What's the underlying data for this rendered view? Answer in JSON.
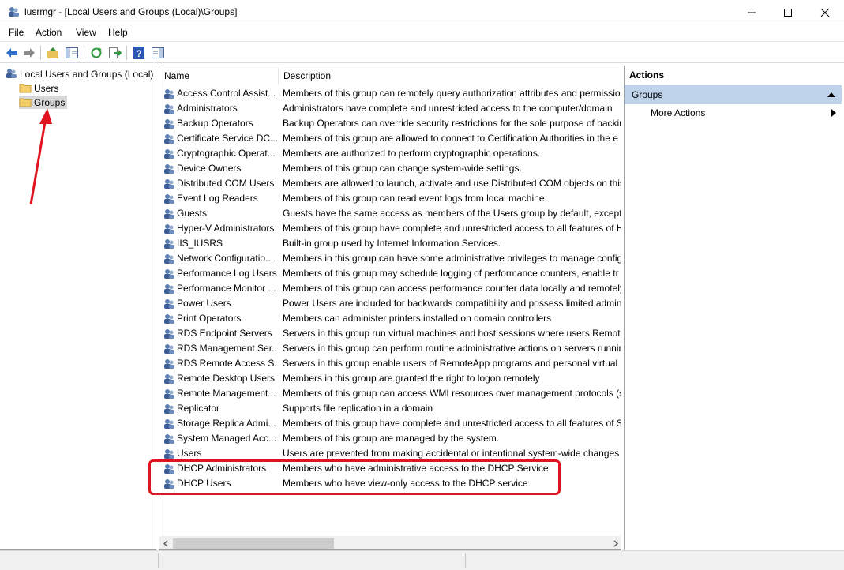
{
  "window": {
    "title": "lusrmgr - [Local Users and Groups (Local)\\Groups]"
  },
  "menu": [
    {
      "label": "File"
    },
    {
      "label": "Action"
    },
    {
      "label": "View"
    },
    {
      "label": "Help"
    }
  ],
  "tree": {
    "root": "Local Users and Groups (Local)",
    "items": [
      {
        "label": "Users"
      },
      {
        "label": "Groups"
      }
    ]
  },
  "list": {
    "columns": [
      "Name",
      "Description"
    ],
    "rows": [
      {
        "name": "Access Control Assist...",
        "desc": "Members of this group can remotely query authorization attributes and permissio"
      },
      {
        "name": "Administrators",
        "desc": "Administrators have complete and unrestricted access to the computer/domain"
      },
      {
        "name": "Backup Operators",
        "desc": "Backup Operators can override security restrictions for the sole purpose of backin"
      },
      {
        "name": "Certificate Service DC...",
        "desc": "Members of this group are allowed to connect to Certification Authorities in the e"
      },
      {
        "name": "Cryptographic Operat...",
        "desc": "Members are authorized to perform cryptographic operations."
      },
      {
        "name": "Device Owners",
        "desc": "Members of this group can change system-wide settings."
      },
      {
        "name": "Distributed COM Users",
        "desc": "Members are allowed to launch, activate and use Distributed COM objects on this"
      },
      {
        "name": "Event Log Readers",
        "desc": "Members of this group can read event logs from local machine"
      },
      {
        "name": "Guests",
        "desc": "Guests have the same access as members of the Users group by default, except fo"
      },
      {
        "name": "Hyper-V Administrators",
        "desc": "Members of this group have complete and unrestricted access to all features of H"
      },
      {
        "name": "IIS_IUSRS",
        "desc": "Built-in group used by Internet Information Services."
      },
      {
        "name": "Network Configuratio...",
        "desc": "Members in this group can have some administrative privileges to manage config"
      },
      {
        "name": "Performance Log Users",
        "desc": "Members of this group may schedule logging of performance counters, enable tr"
      },
      {
        "name": "Performance Monitor ...",
        "desc": "Members of this group can access performance counter data locally and remotely"
      },
      {
        "name": "Power Users",
        "desc": "Power Users are included for backwards compatibility and possess limited admini"
      },
      {
        "name": "Print Operators",
        "desc": "Members can administer printers installed on domain controllers"
      },
      {
        "name": "RDS Endpoint Servers",
        "desc": "Servers in this group run virtual machines and host sessions where users RemoteA"
      },
      {
        "name": "RDS Management Ser...",
        "desc": "Servers in this group can perform routine administrative actions on servers runnin"
      },
      {
        "name": "RDS Remote Access S...",
        "desc": "Servers in this group enable users of RemoteApp programs and personal virtual d"
      },
      {
        "name": "Remote Desktop Users",
        "desc": "Members in this group are granted the right to logon remotely"
      },
      {
        "name": "Remote Management...",
        "desc": "Members of this group can access WMI resources over management protocols (s"
      },
      {
        "name": "Replicator",
        "desc": "Supports file replication in a domain"
      },
      {
        "name": "Storage Replica Admi...",
        "desc": "Members of this group have complete and unrestricted access to all features of St"
      },
      {
        "name": "System Managed Acc...",
        "desc": "Members of this group are managed by the system."
      },
      {
        "name": "Users",
        "desc": "Users are prevented from making accidental or intentional system-wide changes a"
      },
      {
        "name": "DHCP Administrators",
        "desc": "Members who have administrative access to the DHCP Service"
      },
      {
        "name": "DHCP Users",
        "desc": "Members who have view-only access to the DHCP service"
      }
    ]
  },
  "actions": {
    "header": "Actions",
    "group": "Groups",
    "more": "More Actions"
  },
  "colors": {
    "selected_group_bg": "#bfd3ea",
    "annotation_red": "#e0141e"
  }
}
